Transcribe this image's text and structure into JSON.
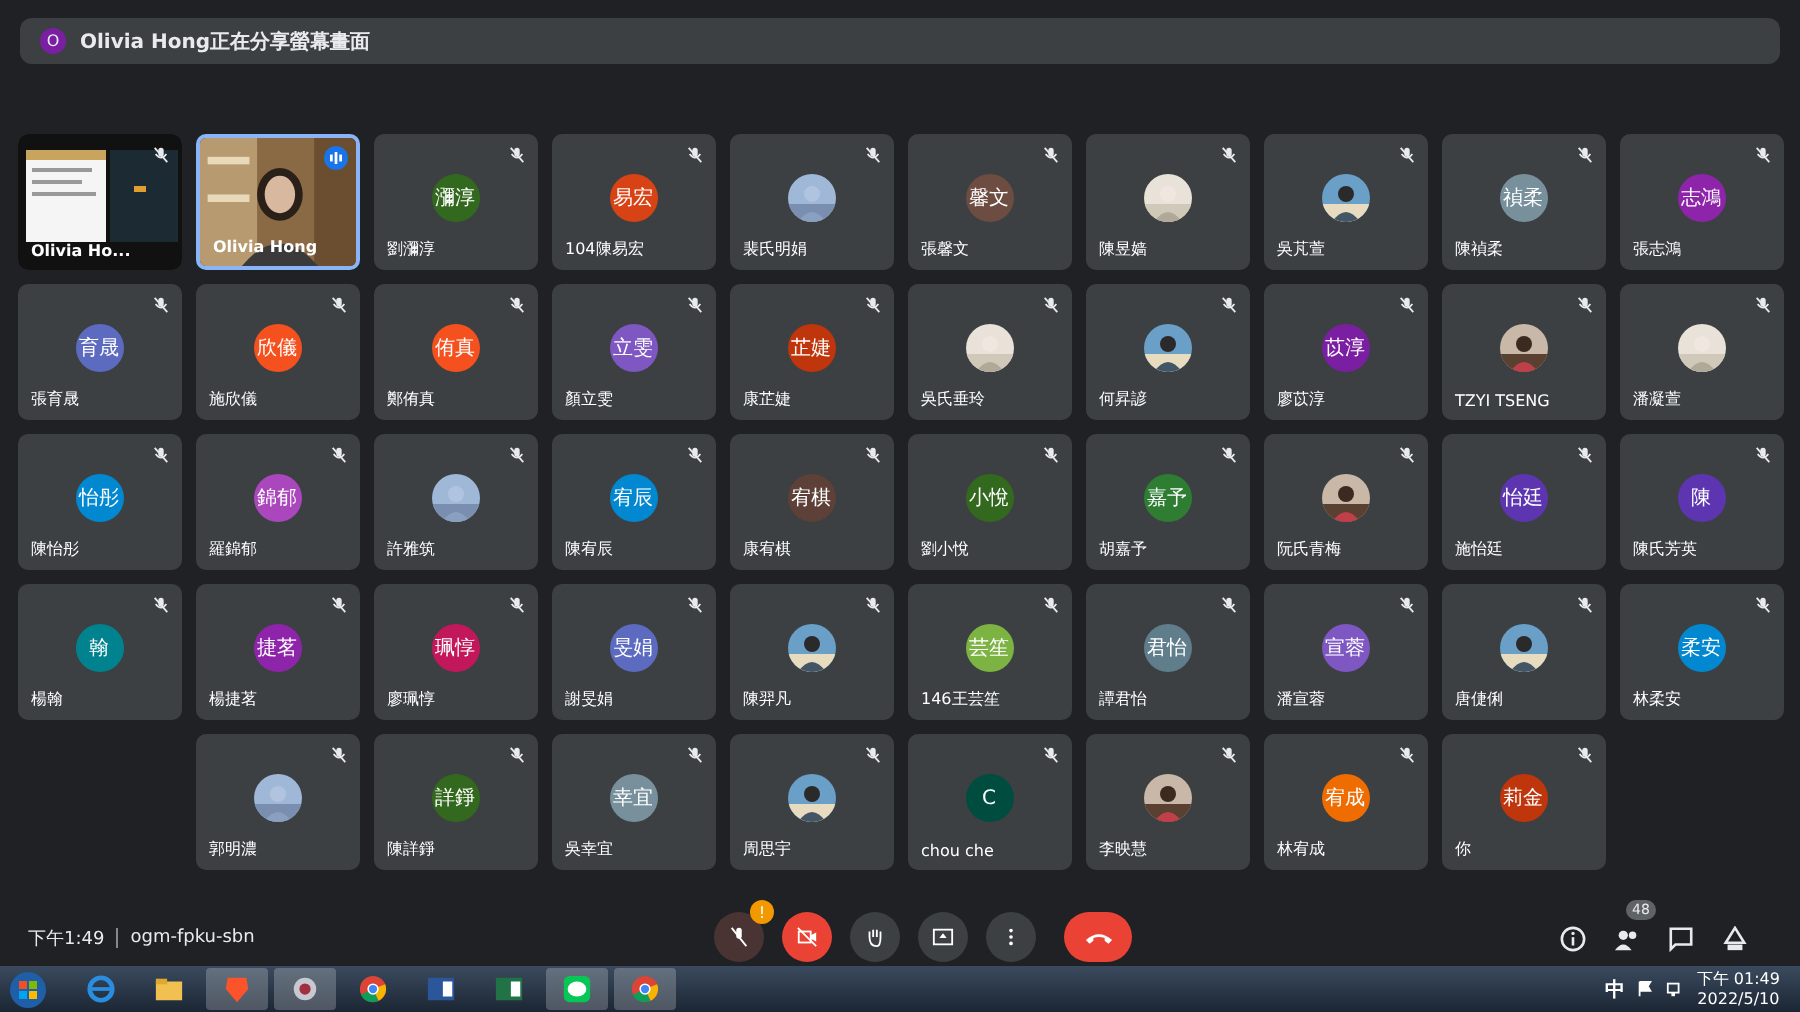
{
  "banner": {
    "initial": "O",
    "text": "Olivia Hong正在分享螢幕畫面"
  },
  "rows": [
    [
      {
        "kind": "screen",
        "name": "Olivia Ho...",
        "muted": true,
        "speaking": false
      },
      {
        "kind": "video",
        "name": "Olivia Hong",
        "muted": false,
        "speaking": true
      },
      {
        "kind": "avatar",
        "name": "劉瀰淳",
        "initials": "瀰淳",
        "color": "#33691e",
        "muted": true,
        "speaking": false
      },
      {
        "kind": "avatar",
        "name": "104陳易宏",
        "initials": "易宏",
        "color": "#d84315",
        "muted": true,
        "speaking": false
      },
      {
        "name": "裴氏明娟",
        "muted": true,
        "speaking": false
      },
      {
        "kind": "avatar",
        "name": "張馨文",
        "initials": "馨文",
        "color": "#6d4c41",
        "muted": true,
        "speaking": false
      },
      {
        "name": "陳昱嫱",
        "muted": true,
        "speaking": false
      },
      {
        "name": "吳芃萱",
        "muted": true,
        "speaking": false
      },
      {
        "kind": "avatar",
        "name": "陳禎柔",
        "initials": "禎柔",
        "color": "#78909c",
        "muted": true,
        "speaking": false
      },
      {
        "kind": "avatar",
        "name": "張志鴻",
        "initials": "志鴻",
        "color": "#8e24aa",
        "muted": true,
        "speaking": false
      }
    ],
    [
      {
        "kind": "avatar",
        "name": "張育晟",
        "initials": "育晟",
        "color": "#5c6bc0",
        "muted": true,
        "speaking": false
      },
      {
        "kind": "avatar",
        "name": "施欣儀",
        "initials": "欣儀",
        "color": "#f4511e",
        "muted": true,
        "speaking": false
      },
      {
        "kind": "avatar",
        "name": "鄭侑真",
        "initials": "侑真",
        "color": "#f4511e",
        "muted": true,
        "speaking": false
      },
      {
        "kind": "avatar",
        "name": "顏立雯",
        "initials": "立雯",
        "color": "#7e57c2",
        "muted": true,
        "speaking": false
      },
      {
        "kind": "avatar",
        "name": "康芷婕",
        "initials": "芷婕",
        "color": "#bf360c",
        "muted": true,
        "speaking": false
      },
      {
        "name": "吳氏垂玲",
        "muted": true,
        "speaking": false
      },
      {
        "name": "何昇諺",
        "muted": true,
        "speaking": false
      },
      {
        "kind": "avatar",
        "name": "廖苡淳",
        "initials": "苡淳",
        "color": "#7b1fa2",
        "muted": true,
        "speaking": false
      },
      {
        "name": "TZYI TSENG",
        "muted": true,
        "speaking": false
      },
      {
        "name": "潘凝萱",
        "muted": true,
        "speaking": false
      }
    ],
    [
      {
        "kind": "avatar",
        "name": "陳怡彤",
        "initials": "怡彤",
        "color": "#0288d1",
        "muted": true,
        "speaking": false
      },
      {
        "kind": "avatar",
        "name": "羅錦郁",
        "initials": "錦郁",
        "color": "#ab47bc",
        "muted": true,
        "speaking": false
      },
      {
        "name": "許雅筑",
        "muted": true,
        "speaking": false
      },
      {
        "kind": "avatar",
        "name": "陳宥辰",
        "initials": "宥辰",
        "color": "#0288d1",
        "muted": true,
        "speaking": false
      },
      {
        "kind": "avatar",
        "name": "康宥棋",
        "initials": "宥棋",
        "color": "#5d4037",
        "muted": true,
        "speaking": false
      },
      {
        "kind": "avatar",
        "name": "劉小悅",
        "initials": "小悅",
        "color": "#33691e",
        "muted": true,
        "speaking": false
      },
      {
        "kind": "avatar",
        "name": "胡嘉予",
        "initials": "嘉予",
        "color": "#2e7d32",
        "muted": true,
        "speaking": false
      },
      {
        "name": "阮氏青梅",
        "muted": true,
        "speaking": false
      },
      {
        "kind": "avatar",
        "name": "施怡廷",
        "initials": "怡廷",
        "color": "#5e35b1",
        "muted": true,
        "speaking": false
      },
      {
        "kind": "avatar",
        "name": "陳氏芳英",
        "initials": "陳",
        "color": "#5e35b1",
        "muted": true,
        "speaking": false
      }
    ],
    [
      {
        "kind": "avatar",
        "name": "楊翰",
        "initials": "翰",
        "color": "#00838f",
        "muted": true,
        "speaking": false
      },
      {
        "kind": "avatar",
        "name": "楊捷茗",
        "initials": "捷茗",
        "color": "#8e24aa",
        "muted": true,
        "speaking": false
      },
      {
        "kind": "avatar",
        "name": "廖珮惇",
        "initials": "珮惇",
        "color": "#c2185b",
        "muted": true,
        "speaking": false
      },
      {
        "kind": "avatar",
        "name": "謝旻娟",
        "initials": "旻娟",
        "color": "#5c6bc0",
        "muted": true,
        "speaking": false
      },
      {
        "name": "陳羿凡",
        "muted": true,
        "speaking": false
      },
      {
        "kind": "avatar",
        "name": "146王芸笙",
        "initials": "芸笙",
        "color": "#7cb342",
        "muted": true,
        "speaking": false
      },
      {
        "kind": "avatar",
        "name": "譚君怡",
        "initials": "君怡",
        "color": "#607d8b",
        "muted": true,
        "speaking": false
      },
      {
        "kind": "avatar",
        "name": "潘宣蓉",
        "initials": "宣蓉",
        "color": "#7e57c2",
        "muted": true,
        "speaking": false
      },
      {
        "name": "唐倢俐",
        "muted": true,
        "speaking": false
      },
      {
        "kind": "avatar",
        "name": "林柔安",
        "initials": "柔安",
        "color": "#0288d1",
        "muted": true,
        "speaking": false
      }
    ],
    [
      {
        "name": "郭明濃",
        "muted": true,
        "speaking": false
      },
      {
        "kind": "avatar",
        "name": "陳詳錚",
        "initials": "詳錚",
        "color": "#33691e",
        "muted": true,
        "speaking": false
      },
      {
        "kind": "avatar",
        "name": "吳幸宜",
        "initials": "幸宜",
        "color": "#78909c",
        "muted": true,
        "speaking": false
      },
      {
        "name": "周思宇",
        "muted": true,
        "speaking": false
      },
      {
        "kind": "avatar",
        "name": "chou che",
        "initials": "C",
        "color": "#004d40",
        "muted": true,
        "speaking": false
      },
      {
        "name": "李映慧",
        "muted": true,
        "speaking": false
      },
      {
        "kind": "avatar",
        "name": "林宥成",
        "initials": "宥成",
        "color": "#ef6c00",
        "muted": true,
        "speaking": false
      },
      {
        "kind": "avatar",
        "name": "你",
        "initials": "莉金",
        "color": "#bf360c",
        "muted": true,
        "speaking": false
      }
    ]
  ],
  "meeting": {
    "time": "下午1:49",
    "code": "ogm-fpku-sbn",
    "mic_alert": "!",
    "people_count": "48"
  },
  "taskbar": {
    "ime": "中",
    "time": "下午 01:49",
    "date": "2022/5/10"
  }
}
